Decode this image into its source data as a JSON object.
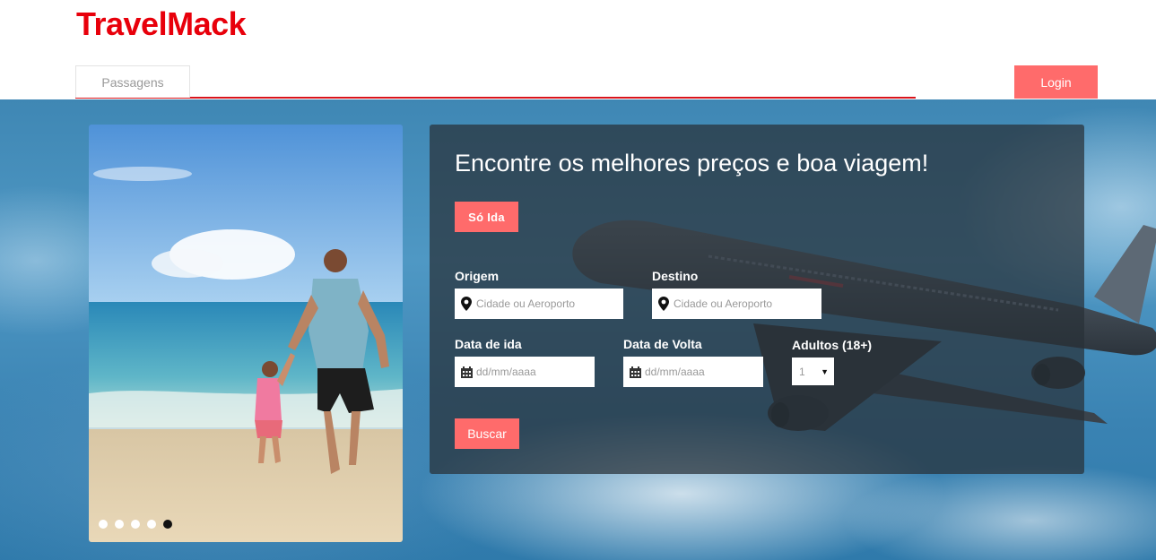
{
  "brand": {
    "logo": "TravelMack"
  },
  "nav": {
    "tabs": [
      {
        "label": "Passagens"
      }
    ],
    "login_label": "Login"
  },
  "carousel": {
    "slide_count": 5,
    "active_index": 4
  },
  "search": {
    "title": "Encontre os melhores preços e boa viagem!",
    "oneway_label": "Só Ida",
    "origin": {
      "label": "Origem",
      "placeholder": "Cidade ou Aeroporto"
    },
    "destination": {
      "label": "Destino",
      "placeholder": "Cidade ou Aeroporto"
    },
    "depart_date": {
      "label": "Data de ida",
      "placeholder": "dd/mm/aaaa"
    },
    "return_date": {
      "label": "Data de Volta",
      "placeholder": "dd/mm/aaaa"
    },
    "adults": {
      "label": "Adultos (18+)",
      "value": "1"
    },
    "submit_label": "Buscar"
  },
  "colors": {
    "brand_red": "#e8000b",
    "accent": "#ff6b6b",
    "nav_underline": "#d9141c"
  }
}
